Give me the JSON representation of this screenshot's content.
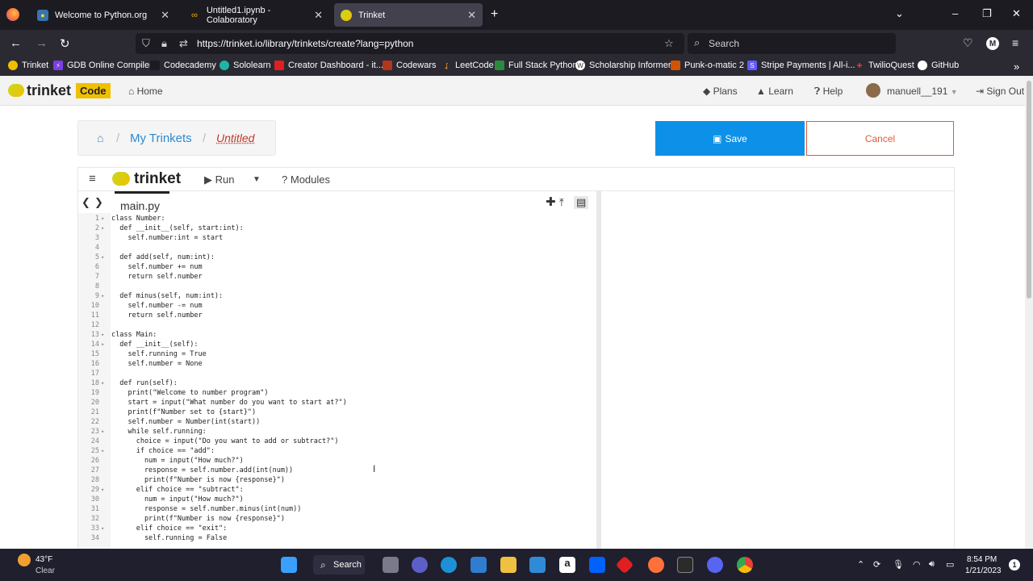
{
  "browser": {
    "tabs": [
      {
        "title": "Welcome to Python.org",
        "active": false
      },
      {
        "title": "Untitled1.ipynb - Colaboratory",
        "active": false
      },
      {
        "title": "Trinket",
        "active": true
      }
    ],
    "url": "https://trinket.io/library/trinkets/create?lang=python",
    "search_placeholder": "Search",
    "profile_initial": "M",
    "bookmarks": [
      "Trinket",
      "GDB Online Compiler",
      "Codecademy",
      "Sololearn",
      "Creator Dashboard - it...",
      "Codewars",
      "LeetCode",
      "Full Stack Python",
      "Scholarship Informer",
      "Punk-o-matic 2",
      "Stripe Payments | All-i...",
      "TwilioQuest",
      "GitHub"
    ]
  },
  "site": {
    "logo": "trinket",
    "logo_badge": "Code",
    "home": "Home",
    "plans": "Plans",
    "learn": "Learn",
    "help": "Help",
    "username": "manuell__191",
    "signout": "Sign Out"
  },
  "breadcrumb": {
    "home_icon": "home-icon",
    "my_trinkets": "My Trinkets",
    "current": "Untitled"
  },
  "actions": {
    "save": "Save",
    "cancel": "Cancel"
  },
  "editor_toolbar": {
    "logo": "trinket",
    "run": "Run",
    "modules": "Modules"
  },
  "editor": {
    "file": "main.py",
    "lines": [
      {
        "n": "1",
        "fold": true,
        "code": "class Number:"
      },
      {
        "n": "2",
        "fold": true,
        "code": "  def __init__(self, start:int):"
      },
      {
        "n": "3",
        "fold": false,
        "code": "    self.number:int = start"
      },
      {
        "n": "4",
        "fold": false,
        "code": ""
      },
      {
        "n": "5",
        "fold": true,
        "code": "  def add(self, num:int):"
      },
      {
        "n": "6",
        "fold": false,
        "code": "    self.number += num"
      },
      {
        "n": "7",
        "fold": false,
        "code": "    return self.number"
      },
      {
        "n": "8",
        "fold": false,
        "code": ""
      },
      {
        "n": "9",
        "fold": true,
        "code": "  def minus(self, num:int):"
      },
      {
        "n": "10",
        "fold": false,
        "code": "    self.number -= num"
      },
      {
        "n": "11",
        "fold": false,
        "code": "    return self.number"
      },
      {
        "n": "12",
        "fold": false,
        "code": ""
      },
      {
        "n": "13",
        "fold": true,
        "code": "class Main:"
      },
      {
        "n": "14",
        "fold": true,
        "code": "  def __init__(self):"
      },
      {
        "n": "15",
        "fold": false,
        "code": "    self.running = True"
      },
      {
        "n": "16",
        "fold": false,
        "code": "    self.number = None"
      },
      {
        "n": "17",
        "fold": false,
        "code": ""
      },
      {
        "n": "18",
        "fold": true,
        "code": "  def run(self):"
      },
      {
        "n": "19",
        "fold": false,
        "code": "    print(\"Welcome to number program\")"
      },
      {
        "n": "20",
        "fold": false,
        "code": "    start = input(\"What number do you want to start at?\")"
      },
      {
        "n": "21",
        "fold": false,
        "code": "    print(f\"Number set to {start}\")"
      },
      {
        "n": "22",
        "fold": false,
        "code": "    self.number = Number(int(start))"
      },
      {
        "n": "23",
        "fold": true,
        "code": "    while self.running:"
      },
      {
        "n": "24",
        "fold": false,
        "code": "      choice = input(\"Do you want to add or subtract?\")"
      },
      {
        "n": "25",
        "fold": true,
        "code": "      if choice == \"add\":"
      },
      {
        "n": "26",
        "fold": false,
        "code": "        num = input(\"How much?\")"
      },
      {
        "n": "27",
        "fold": false,
        "code": "        response = self.number.add(int(num))"
      },
      {
        "n": "28",
        "fold": false,
        "code": "        print(f\"Number is now {response}\")"
      },
      {
        "n": "29",
        "fold": true,
        "code": "      elif choice == \"subtract\":"
      },
      {
        "n": "30",
        "fold": false,
        "code": "        num = input(\"How much?\")"
      },
      {
        "n": "31",
        "fold": false,
        "code": "        response = self.number.minus(int(num))"
      },
      {
        "n": "32",
        "fold": false,
        "code": "        print(f\"Number is now {response}\")"
      },
      {
        "n": "33",
        "fold": true,
        "code": "      elif choice == \"exit\":"
      },
      {
        "n": "34",
        "fold": false,
        "code": "        self.running = False"
      }
    ]
  },
  "taskbar": {
    "temp": "43°F",
    "weather": "Clear",
    "search": "Search",
    "time": "8:54 PM",
    "date": "1/21/2023"
  },
  "colors": {
    "accent": "#0d91e8",
    "cancel": "#e05a3a",
    "brand": "#f0c000"
  }
}
